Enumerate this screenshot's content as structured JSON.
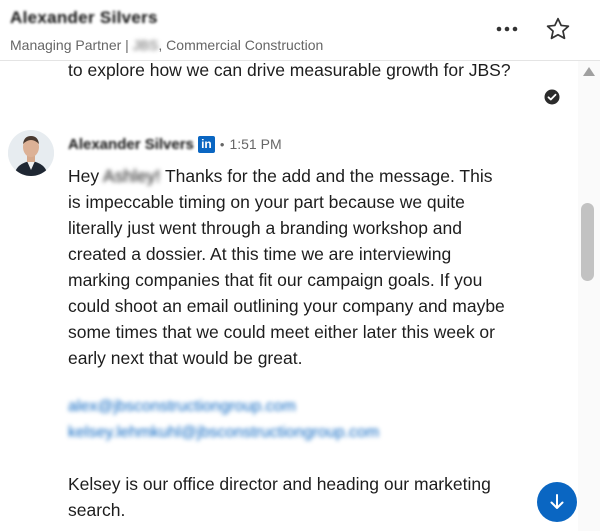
{
  "header": {
    "contact_name": "Alexander Silvers",
    "subtitle_role": "Managing Partner | ",
    "subtitle_company": "JBS",
    "subtitle_rest": ", Commercial Construction"
  },
  "thread": {
    "previous_message": "to explore how we can drive measurable growth for JBS?",
    "message": {
      "sender": "Alexander Silvers",
      "badge": "in",
      "separator": "•",
      "time": "1:51 PM",
      "greeting": "Hey ",
      "greeting_name": "Ashley!",
      "body": " Thanks for the add and the message. This is impeccable timing on your part because we quite literally just went through a branding workshop and created a dossier. At this time we are interviewing marking companies that fit our campaign goals. If you could shoot an email outlining your company and maybe some times that we could meet either later this week or early next that would be great.",
      "email_1": "alex@jbsconstructiongroup.com",
      "email_2": "kelsey.lehmkuhl@jbsconstructiongroup.com",
      "tail": "Kelsey is our office director and heading our marketing search."
    }
  },
  "icons": [
    "more-options-icon",
    "star-icon",
    "read-receipt-check-icon",
    "linkedin-icon",
    "scroll-up-arrow-icon",
    "arrow-down-icon"
  ],
  "colors": {
    "accent": "#0a66c2",
    "text": "#1d1d1d",
    "muted": "#666666"
  }
}
